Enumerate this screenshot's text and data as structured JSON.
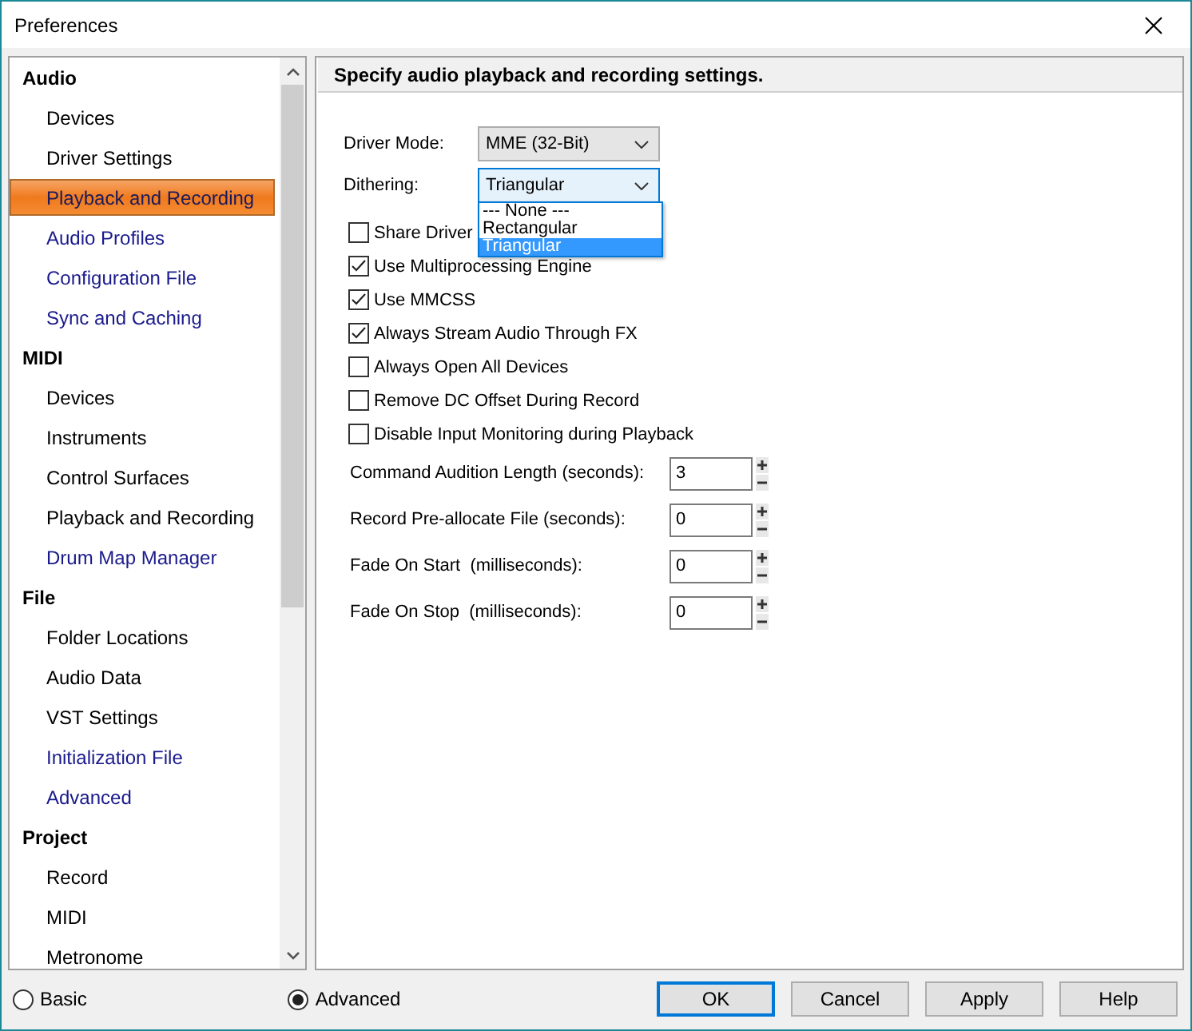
{
  "window": {
    "title": "Preferences"
  },
  "sidebar": {
    "groups": [
      {
        "label": "Audio",
        "items": [
          {
            "label": "Devices",
            "selected": false,
            "visited": false
          },
          {
            "label": "Driver Settings",
            "selected": false,
            "visited": false
          },
          {
            "label": "Playback and Recording",
            "selected": true,
            "visited": false
          },
          {
            "label": "Audio Profiles",
            "selected": false,
            "visited": true
          },
          {
            "label": "Configuration File",
            "selected": false,
            "visited": true
          },
          {
            "label": "Sync and Caching",
            "selected": false,
            "visited": true
          }
        ]
      },
      {
        "label": "MIDI",
        "items": [
          {
            "label": "Devices",
            "selected": false,
            "visited": false
          },
          {
            "label": "Instruments",
            "selected": false,
            "visited": false
          },
          {
            "label": "Control Surfaces",
            "selected": false,
            "visited": false
          },
          {
            "label": "Playback and Recording",
            "selected": false,
            "visited": false
          },
          {
            "label": "Drum Map Manager",
            "selected": false,
            "visited": true
          }
        ]
      },
      {
        "label": "File",
        "items": [
          {
            "label": "Folder Locations",
            "selected": false,
            "visited": false
          },
          {
            "label": "Audio Data",
            "selected": false,
            "visited": false
          },
          {
            "label": "VST Settings",
            "selected": false,
            "visited": false
          },
          {
            "label": "Initialization File",
            "selected": false,
            "visited": true
          },
          {
            "label": "Advanced",
            "selected": false,
            "visited": true
          }
        ]
      },
      {
        "label": "Project",
        "items": [
          {
            "label": "Record",
            "selected": false,
            "visited": false
          },
          {
            "label": "MIDI",
            "selected": false,
            "visited": false
          },
          {
            "label": "Metronome",
            "selected": false,
            "visited": false
          }
        ]
      }
    ]
  },
  "panel": {
    "heading": "Specify audio playback and recording settings.",
    "dropdowns": [
      {
        "label": "Driver Mode:",
        "value": "MME (32-Bit)",
        "focused": false,
        "expanded": false
      },
      {
        "label": "Dithering:",
        "value": "Triangular",
        "focused": true,
        "expanded": true,
        "options": [
          {
            "label": "--- None ---",
            "selected": false
          },
          {
            "label": "Rectangular",
            "selected": false
          },
          {
            "label": "Triangular",
            "selected": true
          }
        ]
      }
    ],
    "checkboxes": [
      {
        "label": "Share Driver",
        "checked": false
      },
      {
        "label": "Use Multiprocessing Engine",
        "checked": true
      },
      {
        "label": "Use MMCSS",
        "checked": true
      },
      {
        "label": "Always Stream Audio Through FX",
        "checked": true
      },
      {
        "label": "Always Open All Devices",
        "checked": false
      },
      {
        "label": "Remove DC Offset During Record",
        "checked": false
      },
      {
        "label": "Disable Input Monitoring during Playback",
        "checked": false
      }
    ],
    "number_fields": [
      {
        "label": "Command Audition Length (seconds):",
        "value": "3"
      },
      {
        "label": "Record Pre-allocate File (seconds):",
        "value": "0"
      },
      {
        "label": "Fade On Start  (milliseconds):",
        "value": "0"
      },
      {
        "label": "Fade On Stop  (milliseconds):",
        "value": "0"
      }
    ]
  },
  "mode": [
    {
      "label": "Basic",
      "selected": false
    },
    {
      "label": "Advanced",
      "selected": true
    }
  ],
  "buttons": [
    {
      "label": "OK",
      "focused": true
    },
    {
      "label": "Cancel",
      "focused": false
    },
    {
      "label": "Apply",
      "focused": false
    },
    {
      "label": "Help",
      "focused": false
    }
  ]
}
